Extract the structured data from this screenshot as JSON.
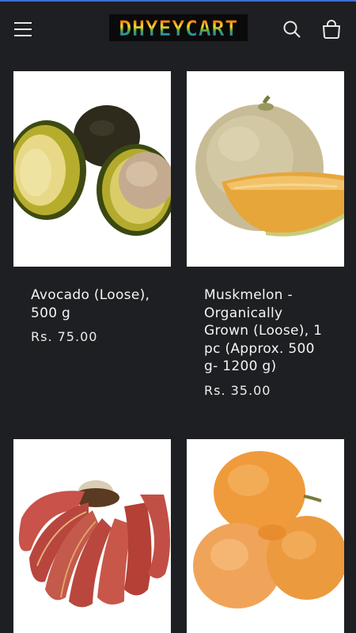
{
  "header": {
    "logo_text": "DHYEYCART",
    "icons": [
      "menu-icon",
      "search-icon",
      "cart-icon"
    ],
    "accent_color": "#3b6fd6"
  },
  "products": [
    {
      "title": "Avocado (Loose), 500 g",
      "price": "Rs. 75.00",
      "image": "avocado"
    },
    {
      "title": "Muskmelon - Organically Grown (Loose), 1 pc (Approx. 500 g- 1200 g)",
      "price": "Rs. 35.00",
      "image": "muskmelon"
    },
    {
      "image": "red-bananas"
    },
    {
      "image": "oranges"
    }
  ]
}
